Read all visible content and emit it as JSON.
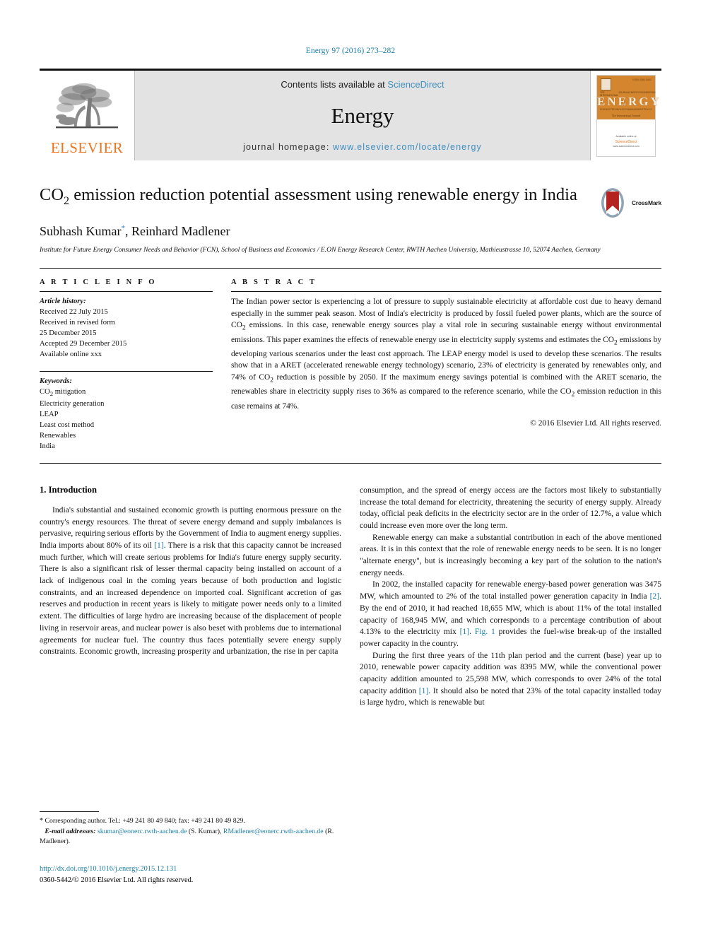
{
  "running_head": "Energy 97 (2016) 273–282",
  "masthead": {
    "publisher_logo_text": "ELSEVIER",
    "contents_prefix": "Contents lists available at ",
    "contents_link": "ScienceDirect",
    "journal_name": "Energy",
    "homepage_prefix": "journal homepage: ",
    "homepage_url": "www.elsevier.com/locate/energy",
    "cover": {
      "issue_label": "ISSN 0360-5442",
      "title": "ENERGY",
      "tags_top": [
        "THE INTERNATIONAL",
        "JOURNAL",
        "ENERGY",
        "ENGINEERING"
      ],
      "tags_bottom": [
        "SCIENCE",
        "TECHNOLOGY",
        "MANAGEMENT",
        "POLICY"
      ],
      "subtitle": "The International Journal",
      "publisher": "Available online at",
      "brand": "ScienceDirect",
      "brand_sub": "www.sciencedirect.com"
    }
  },
  "article": {
    "title_line1_pre": "CO",
    "title_sub": "2",
    "title_line1_post": " emission reduction potential assessment using renewable energy",
    "title_line2": "in India",
    "authors": "Subhash Kumar",
    "author_marker": "*",
    "authors_rest": ", Reinhard Madlener",
    "affiliation": "Institute for Future Energy Consumer Needs and Behavior (FCN), School of Business and Economics / E.ON Energy Research Center, RWTH Aachen University, Mathieustrasse 10, 52074 Aachen, Germany",
    "crossmark_label": "CrossMark"
  },
  "article_info": {
    "heading": "A R T I C L E    I N F O",
    "history_label": "Article history:",
    "history": [
      "Received 22 July 2015",
      "Received in revised form",
      "25 December 2015",
      "Accepted 29 December 2015",
      "Available online xxx"
    ],
    "keywords_label": "Keywords:",
    "keywords_html": "CO<sub>2</sub> mitigation",
    "keywords": [
      "Electricity generation",
      "LEAP",
      "Least cost method",
      "Renewables",
      "India"
    ]
  },
  "abstract": {
    "heading": "A B S T R A C T",
    "body_html": "The Indian power sector is experiencing a lot of pressure to supply sustainable electricity at affordable cost due to heavy demand especially in the summer peak season. Most of India's electricity is produced by fossil fueled power plants, which are the source of CO<sub>2</sub> emissions. In this case, renewable energy sources play a vital role in securing sustainable energy without environmental emissions. This paper examines the effects of renewable energy use in electricity supply systems and estimates the CO<sub>2</sub> emissions by developing various scenarios under the least cost approach. The LEAP energy model is used to develop these scenarios. The results show that in a ARET (accelerated renewable energy technology) scenario, 23% of electricity is generated by renewables only, and 74% of CO<sub>2</sub> reduction is possible by 2050. If the maximum energy savings potential is combined with the ARET scenario, the renewables share in electricity supply rises to 36% as compared to the reference scenario, while the CO<sub>2</sub> emission reduction in this case remains at 74%.",
    "copyright": "© 2016 Elsevier Ltd. All rights reserved."
  },
  "intro": {
    "heading": "1.  Introduction",
    "left_html": "<p>India's substantial and sustained economic growth is putting enormous pressure on the country's energy resources. The threat of severe energy demand and supply imbalances is pervasive, requiring serious efforts by the Government of India to augment energy supplies. India imports about 80% of its oil <span class=\"lnk\">[1]</span>. There is a risk that this capacity cannot be increased much further, which will create serious problems for India's future energy supply security. There is also a significant risk of lesser thermal capacity being installed on account of a lack of indigenous coal in the coming years because of both production and logistic constraints, and an increased dependence on imported coal. Significant accretion of gas reserves and production in recent years is likely to mitigate power needs only to a limited extent. The difficulties of large hydro are increasing because of the displacement of people living in reservoir areas, and nuclear power is also beset with problems due to international agreements for nuclear fuel. The country thus faces potentially severe energy supply constraints. Economic growth, increasing prosperity and urbanization, the rise in per capita</p>",
    "right_html": "<p style=\"text-indent:0\">consumption, and the spread of energy access are the factors most likely to substantially increase the total demand for electricity, threatening the security of energy supply. Already today, official peak deficits in the electricity sector are in the order of 12.7%, a value which could increase even more over the long term.</p><p>Renewable energy can make a substantial contribution in each of the above mentioned areas. It is in this context that the role of renewable energy needs to be seen. It is no longer \"alternate energy\", but is increasingly becoming a key part of the solution to the nation's energy needs.</p><p>In 2002, the installed capacity for renewable energy-based power generation was 3475 MW, which amounted to 2% of the total installed power generation capacity in India <span class=\"lnk\">[2]</span>. By the end of 2010, it had reached 18,655 MW, which is about 11% of the total installed capacity of 168,945 MW, and which corresponds to a percentage contribution of about 4.13% to the electricity mix <span class=\"lnk\">[1]</span>. <span class=\"lnk\">Fig. 1</span> provides the fuel-wise break-up of the installed power capacity in the country.</p><p>During the first three years of the 11th plan period and the current (base) year up to 2010, renewable power capacity addition was 8395 MW, while the conventional power capacity addition amounted to 25,598 MW, which corresponds to over 24% of the total capacity addition <span class=\"lnk\">[1]</span>. It should also be noted that 23% of the total capacity installed today is large hydro, which is renewable but</p>"
  },
  "footnote": {
    "html": "<span class=\"star\">*</span>  Corresponding author. Tel.: +49 241 80 49 840; fax: +49 241 80 49 829.<br>&nbsp;&nbsp;&nbsp;<i><b>E-mail addresses:</b></i> <span class=\"lnk\">skumar@eonerc.rwth-aachen.de</span> (S. Kumar), <span class=\"lnk\">RMadlener@eonerc.rwth-aachen.de</span> (R. Madlener)."
  },
  "footer": {
    "doi": "http://dx.doi.org/10.1016/j.energy.2015.12.131",
    "issn_copyright": "0360-5442/© 2016 Elsevier Ltd. All rights reserved."
  },
  "colors": {
    "link_blue": "#1b7fa8",
    "sciencedirect_blue": "#3f8fc0",
    "elsevier_orange": "#E87722",
    "cover_orange": "#D4862F",
    "masthead_grey": "#e3e3e3"
  }
}
